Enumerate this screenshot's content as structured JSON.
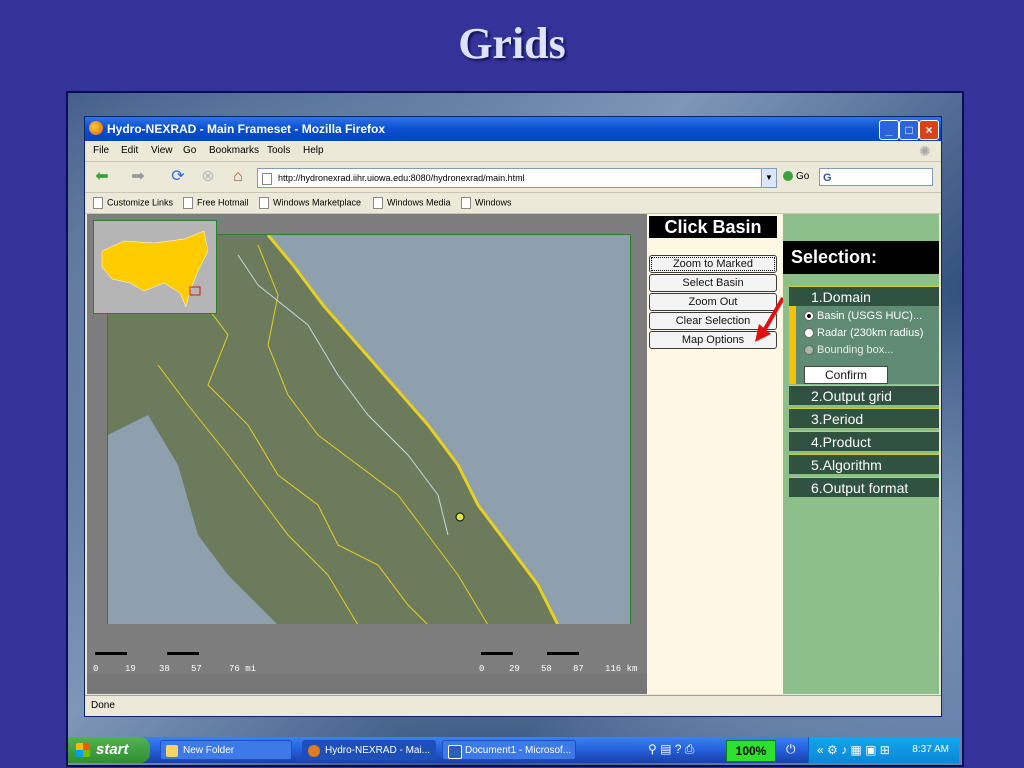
{
  "slide": {
    "title": "Grids"
  },
  "window": {
    "title": "Hydro-NEXRAD - Main Frameset - Mozilla Firefox",
    "menu": [
      "File",
      "Edit",
      "View",
      "Go",
      "Bookmarks",
      "Tools",
      "Help"
    ],
    "url": "http://hydronexrad.iihr.uiowa.edu:8080/hydronexrad/main.html",
    "go_label": "Go",
    "search_value": "G",
    "bookmarks": [
      "Customize Links",
      "Free Hotmail",
      "Windows Marketplace",
      "Windows Media",
      "Windows"
    ],
    "status": "Done"
  },
  "map": {
    "scale_left": [
      "0",
      "19",
      "38",
      "57",
      "76 mi"
    ],
    "scale_right": [
      "0",
      "29",
      "58",
      "87",
      "116 km"
    ]
  },
  "panel": {
    "header": "Click Basin",
    "buttons": [
      "Zoom to Marked",
      "Select Basin",
      "Zoom Out",
      "Clear Selection",
      "Map Options"
    ]
  },
  "selection": {
    "header": "Selection:",
    "steps": [
      "1.Domain",
      "2.Output grid",
      "3.Period",
      "4.Product",
      "5.Algorithm",
      "6.Output format"
    ],
    "domain_options": [
      "Basin (USGS HUC)...",
      "Radar (230km radius)",
      "Bounding box..."
    ],
    "selected_option": "Basin (USGS HUC)...",
    "confirm_label": "Confirm"
  },
  "taskbar": {
    "start_label": "start",
    "tasks": [
      "New Folder",
      "Hydro-NEXRAD - Mai...",
      "Document1 - Microsof..."
    ],
    "zoom": "100%",
    "clock": "8:37 AM"
  },
  "colors": {
    "land": "#6c7b5b",
    "water": "#8e9fae",
    "basin_lines": "#e8d020",
    "accent_arrow": "#e01010"
  }
}
